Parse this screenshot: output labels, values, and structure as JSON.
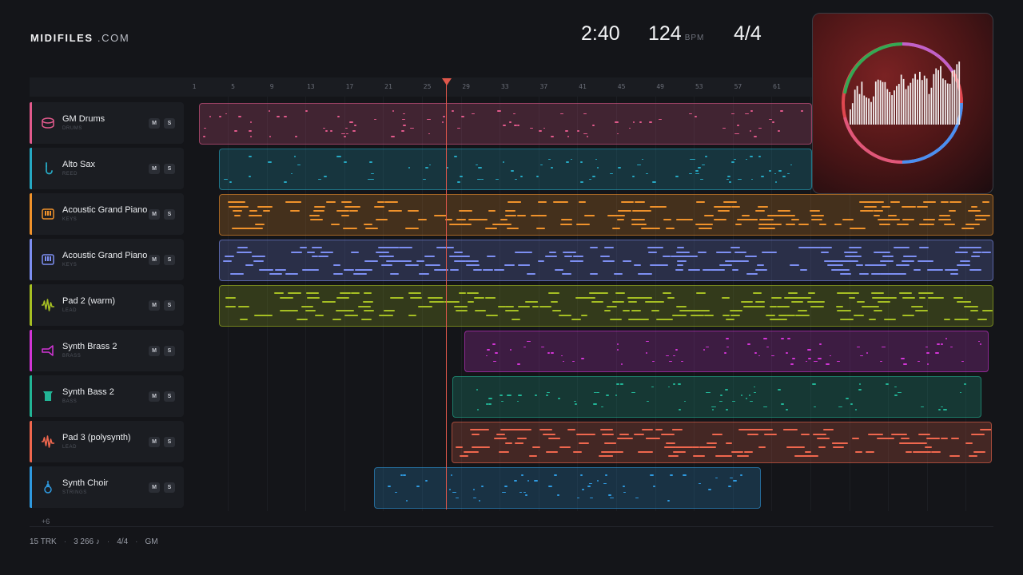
{
  "brand": {
    "name": "MIDIFILES",
    "suffix": ".COM"
  },
  "transport": {
    "time": "2:40",
    "bpm": "124",
    "bpm_unit": "BPM",
    "signature": "4/4"
  },
  "ruler": {
    "bars": [
      "1",
      "5",
      "9",
      "13",
      "17",
      "21",
      "25",
      "29",
      "33",
      "37",
      "41",
      "45",
      "49",
      "53",
      "57",
      "61"
    ]
  },
  "tracks": [
    {
      "name": "GM Drums",
      "category": "DRUMS",
      "color": "#e25a8c",
      "icon": "drum-icon",
      "mute": "M",
      "solo": "S"
    },
    {
      "name": "Alto Sax",
      "category": "REED",
      "color": "#26a9c4",
      "icon": "sax-icon",
      "mute": "M",
      "solo": "S"
    },
    {
      "name": "Acoustic Grand Piano",
      "category": "KEYS",
      "color": "#f0922b",
      "icon": "piano-icon",
      "mute": "M",
      "solo": "S"
    },
    {
      "name": "Acoustic Grand Piano",
      "category": "KEYS",
      "color": "#7d8ff2",
      "icon": "piano-icon",
      "mute": "M",
      "solo": "S"
    },
    {
      "name": "Pad 2 (warm)",
      "category": "LEAD",
      "color": "#a6bf23",
      "icon": "waveform-icon",
      "mute": "M",
      "solo": "S"
    },
    {
      "name": "Synth Brass 2",
      "category": "BRASS",
      "color": "#d235d6",
      "icon": "trumpet-icon",
      "mute": "M",
      "solo": "S"
    },
    {
      "name": "Synth Bass 2",
      "category": "BASS",
      "color": "#22b596",
      "icon": "bass-amp-icon",
      "mute": "M",
      "solo": "S"
    },
    {
      "name": "Pad 3 (polysynth)",
      "category": "LEAD",
      "color": "#f0674e",
      "icon": "waveform-icon",
      "mute": "M",
      "solo": "S"
    },
    {
      "name": "Synth Choir",
      "category": "STRINGS",
      "color": "#2f9ae0",
      "icon": "violin-icon",
      "mute": "M",
      "solo": "S"
    }
  ],
  "more_tracks": "+6",
  "footer": {
    "tracks": "15 TRK",
    "notes": "3 266 ♪",
    "signature": "4/4",
    "standard": "GM"
  }
}
